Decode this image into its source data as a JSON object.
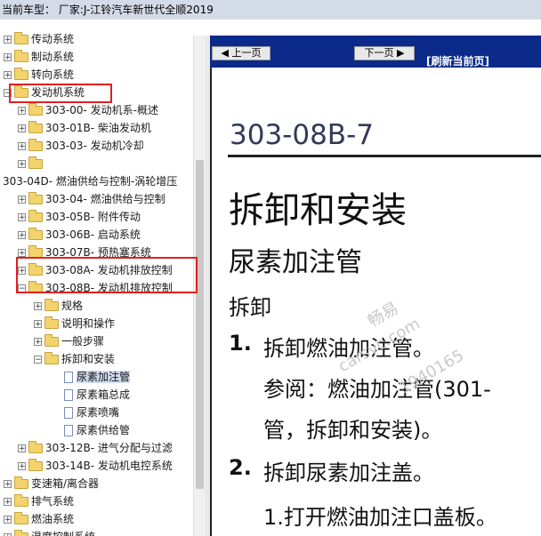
{
  "title": "当前车型： 厂家:J-江铃汽车新世代全顺2019",
  "tree": [
    {
      "label": "传动系统",
      "level": 0,
      "type": "folder",
      "expander": "+"
    },
    {
      "label": "制动系统",
      "level": 0,
      "type": "folder",
      "expander": "+"
    },
    {
      "label": "转向系统",
      "level": 0,
      "type": "folder",
      "expander": "+"
    },
    {
      "label": "发动机系统",
      "level": 0,
      "type": "folder",
      "expander": "-"
    },
    {
      "label": "303-00- 发动机系-概述",
      "level": 1,
      "type": "folder",
      "expander": "+"
    },
    {
      "label": "303-01B- 柴油发动机",
      "level": 1,
      "type": "folder",
      "expander": "+"
    },
    {
      "label": "303-03- 发动机冷却",
      "level": 1,
      "type": "folder",
      "expander": "+"
    },
    {
      "label": "",
      "level": 1,
      "type": "folder",
      "expander": "+"
    },
    {
      "label": "303-04D- 燃油供给与控制-涡轮增压",
      "level": -1,
      "type": "text",
      "expander": ""
    },
    {
      "label": "303-04- 燃油供给与控制",
      "level": 1,
      "type": "folder",
      "expander": "+"
    },
    {
      "label": "303-05B- 附件传动",
      "level": 1,
      "type": "folder",
      "expander": "+"
    },
    {
      "label": "303-06B- 启动系统",
      "level": 1,
      "type": "folder",
      "expander": "+"
    },
    {
      "label": "303-07B- 预热塞系统",
      "level": 1,
      "type": "folder",
      "expander": "+"
    },
    {
      "label": "303-08A- 发动机排放控制",
      "level": 1,
      "type": "folder",
      "expander": "+"
    },
    {
      "label": "303-08B- 发动机排放控制",
      "level": 1,
      "type": "folder",
      "expander": "-"
    },
    {
      "label": "规格",
      "level": 2,
      "type": "folder",
      "expander": "+"
    },
    {
      "label": "说明和操作",
      "level": 2,
      "type": "folder",
      "expander": "+"
    },
    {
      "label": "一般步骤",
      "level": 2,
      "type": "folder",
      "expander": "+"
    },
    {
      "label": "拆卸和安装",
      "level": 2,
      "type": "folder",
      "expander": "-"
    },
    {
      "label": "尿素加注管",
      "level": 3,
      "type": "doc",
      "expander": "",
      "selected": true
    },
    {
      "label": "尿素箱总成",
      "level": 3,
      "type": "doc",
      "expander": ""
    },
    {
      "label": "尿素喷嘴",
      "level": 3,
      "type": "doc",
      "expander": ""
    },
    {
      "label": "尿素供给管",
      "level": 3,
      "type": "doc",
      "expander": ""
    },
    {
      "label": "303-12B- 进气分配与过滤",
      "level": 1,
      "type": "folder",
      "expander": "+"
    },
    {
      "label": "303-14B- 发动机电控系统",
      "level": 1,
      "type": "folder",
      "expander": "+"
    },
    {
      "label": "变速箱/离合器",
      "level": 0,
      "type": "folder",
      "expander": "+"
    },
    {
      "label": "排气系统",
      "level": 0,
      "type": "folder",
      "expander": "+"
    },
    {
      "label": "燃油系统",
      "level": 0,
      "type": "folder",
      "expander": "+"
    },
    {
      "label": "温度控制系统",
      "level": 0,
      "type": "folder",
      "expander": "+"
    }
  ],
  "nav": {
    "prev": "上一页",
    "next": "下一页",
    "refresh": "[刷新当前页]"
  },
  "document": {
    "id": "303-08B-7",
    "heading": "拆卸和安装",
    "subheading": "尿素加注管",
    "section": "拆卸",
    "step1_num": "1.",
    "step1": "拆卸燃油加注管。",
    "step1_ref_a": "参阅：燃油加注管(301-",
    "step1_ref_b": "管，拆卸和安装)。",
    "step2_num": "2.",
    "step2": "拆卸尿素加注盖。",
    "step2_sub": "1.打开燃油加注口盖板。"
  },
  "watermark": {
    "line1": "畅易",
    "line2": "carsvc.com",
    "line3": "1940165"
  }
}
